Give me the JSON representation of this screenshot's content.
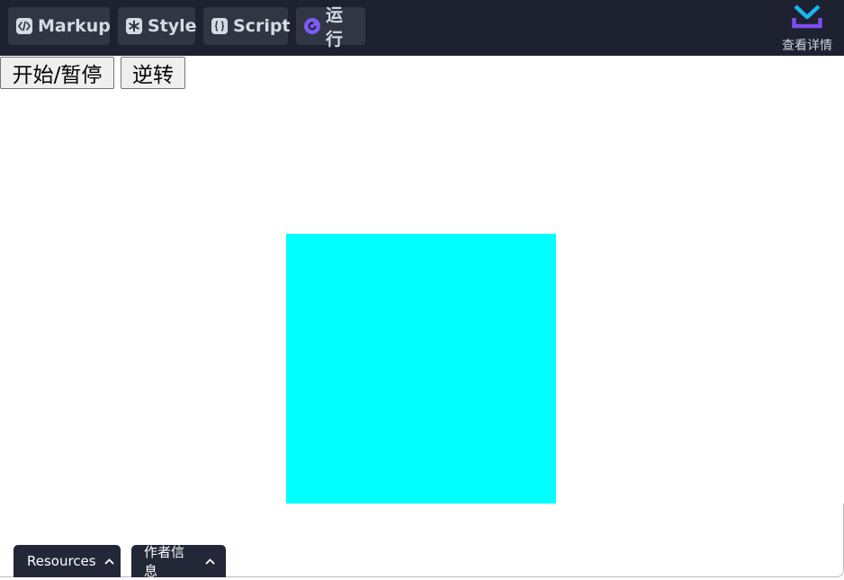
{
  "toolbar": {
    "markup_label": "Markup",
    "style_label": "Style",
    "script_label": "Script",
    "run_label": "运行",
    "details_label": "查看详情"
  },
  "demo": {
    "toggle_label": "开始/暂停",
    "reverse_label": "逆转",
    "box_color": "#00ffff"
  },
  "bottom_tabs": {
    "resources_label": "Resources",
    "author_label": "作者信息"
  },
  "colors": {
    "toolbar_bg": "#1d2130",
    "button_bg": "#313645",
    "run_icon": "#7b5cf5",
    "details_icon_top": "#19b5f0",
    "details_icon_bottom": "#7b4ff0"
  },
  "icons": {
    "markup": "code-icon",
    "style": "asterisk-icon",
    "script": "braces-icon",
    "run": "run-icon",
    "details": "download-icon",
    "chevron": "chevron-up-icon"
  }
}
